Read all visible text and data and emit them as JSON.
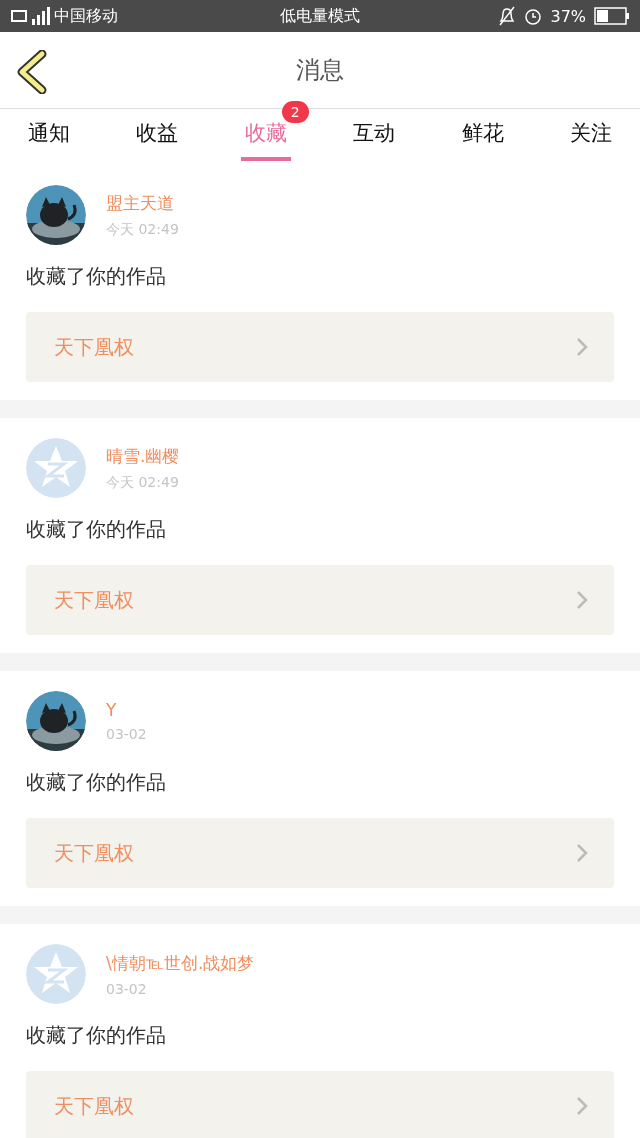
{
  "status_bar": {
    "carrier": "中国移动",
    "mode": "低电量模式",
    "battery": "37%"
  },
  "header": {
    "title": "消息"
  },
  "tabs": [
    {
      "label": "通知",
      "selected": false
    },
    {
      "label": "收益",
      "selected": false
    },
    {
      "label": "收藏",
      "selected": true,
      "badge": "2"
    },
    {
      "label": "互动",
      "selected": false
    },
    {
      "label": "鲜花",
      "selected": false
    },
    {
      "label": "关注",
      "selected": false
    }
  ],
  "messages": [
    {
      "kind": "picture",
      "name": "盟主天道",
      "time": "今天 02:49",
      "text": "收藏了你的作品",
      "work": "天下凰权"
    },
    {
      "kind": "default",
      "name": "晴雪.幽樱",
      "time": "今天 02:49",
      "text": "收藏了你的作品",
      "work": "天下凰权"
    },
    {
      "kind": "picture",
      "name": "Y",
      "time": "03-02",
      "text": "收藏了你的作品",
      "work": "天下凰权"
    },
    {
      "kind": "default",
      "name": "\\情朝℡世创.战如梦",
      "time": "03-02",
      "text": "收藏了你的作品",
      "work": "天下凰权"
    }
  ]
}
